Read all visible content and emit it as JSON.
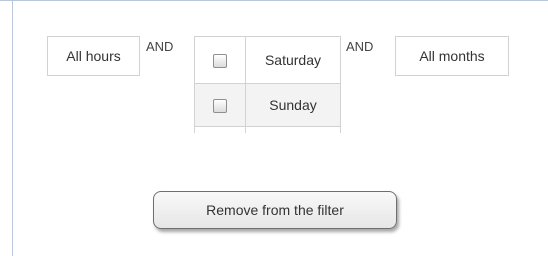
{
  "filter": {
    "hours_value": "All hours",
    "connector_1": "AND",
    "days": [
      {
        "label": "Saturday",
        "checked": false
      },
      {
        "label": "Sunday",
        "checked": false
      }
    ],
    "connector_2": "AND",
    "months_value": "All months"
  },
  "actions": {
    "remove_label": "Remove from the filter"
  },
  "colors": {
    "border": "#d2d2d2",
    "panel_border": "#b9c6db",
    "text": "#333333",
    "row_alt": "#f3f3f3"
  }
}
